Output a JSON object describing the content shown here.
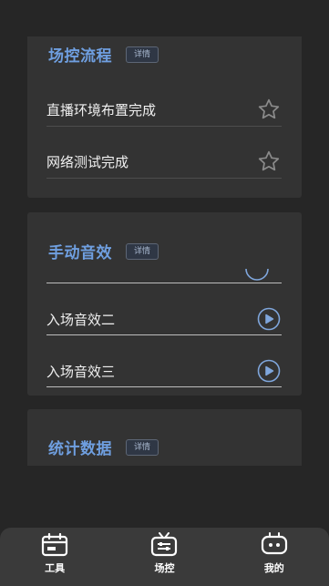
{
  "flow": {
    "title": "场控流程",
    "detail": "详情",
    "items": [
      {
        "label": "直播环境布置完成",
        "icon": "star-outline-icon"
      },
      {
        "label": "网络测试完成",
        "icon": "star-outline-icon"
      }
    ]
  },
  "sound": {
    "title": "手动音效",
    "detail": "详情",
    "items": [
      {
        "label": "入场音效二",
        "icon": "play-circle-icon"
      },
      {
        "label": "入场音效三",
        "icon": "play-circle-icon"
      }
    ]
  },
  "stats": {
    "title": "统计数据",
    "detail": "详情"
  },
  "tabbar": {
    "items": [
      {
        "label": "工具",
        "icon": "calendar-icon"
      },
      {
        "label": "场控",
        "icon": "tv-icon"
      },
      {
        "label": "我的",
        "icon": "robot-icon"
      }
    ]
  },
  "colors": {
    "accent": "#6f9fe0",
    "card": "#333333",
    "background": "#262626",
    "tabbar": "#3a3a3a"
  }
}
